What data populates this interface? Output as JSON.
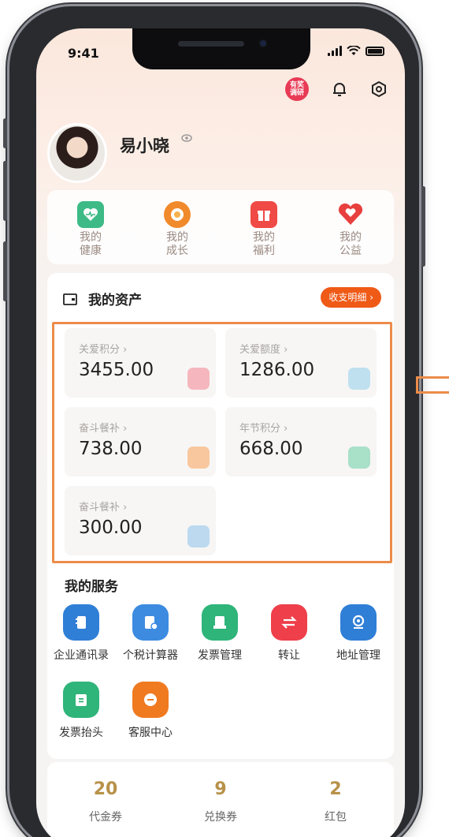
{
  "status": {
    "time": "9:41"
  },
  "header": {
    "survey_badge": [
      "有奖",
      "调研"
    ],
    "icons": [
      "survey-icon",
      "bell-icon",
      "settings-hex-icon"
    ]
  },
  "profile": {
    "name": "易小晓"
  },
  "quick": [
    {
      "label1": "我的",
      "label2": "健康",
      "icon": "heart-pulse-icon",
      "color": "#3dba86"
    },
    {
      "label1": "我的",
      "label2": "成长",
      "icon": "medal-icon",
      "color": "#f08a2b"
    },
    {
      "label1": "我的",
      "label2": "福利",
      "icon": "gift-icon",
      "color": "#ef4a45"
    },
    {
      "label1": "我的",
      "label2": "公益",
      "icon": "charity-heart-icon",
      "color": "#e8403e"
    }
  ],
  "assets": {
    "title": "我的资产",
    "detail_label": "收支明细",
    "tiles": [
      {
        "label": "关爱积分",
        "value": "3455.00",
        "icon_color": "#f5b7bd"
      },
      {
        "label": "关爱额度",
        "value": "1286.00",
        "icon_color": "#bfe0ef"
      },
      {
        "label": "奋斗餐补",
        "value": "738.00",
        "icon_color": "#f8c79e"
      },
      {
        "label": "年节积分",
        "value": "668.00",
        "icon_color": "#a9e0c8"
      },
      {
        "label": "奋斗餐补",
        "value": "300.00",
        "icon_color": "#bcd9ef"
      }
    ]
  },
  "services": {
    "title": "我的服务",
    "items": [
      {
        "label": "企业通讯录",
        "icon": "contacts-icon",
        "color": "#2f7fd6"
      },
      {
        "label": "个税计算器",
        "icon": "calculator-icon",
        "color": "#3c8be0"
      },
      {
        "label": "发票管理",
        "icon": "invoice-icon",
        "color": "#2fb47a"
      },
      {
        "label": "转让",
        "icon": "transfer-icon",
        "color": "#ee3f4a"
      },
      {
        "label": "地址管理",
        "icon": "location-icon",
        "color": "#2f7fd6"
      },
      {
        "label": "发票抬头",
        "icon": "invoice-title-icon",
        "color": "#2fb47a"
      },
      {
        "label": "客服中心",
        "icon": "customer-service-icon",
        "color": "#f07a20"
      }
    ]
  },
  "stats": [
    {
      "value": "20",
      "label": "代金券"
    },
    {
      "value": "9",
      "label": "兑换券"
    },
    {
      "value": "2",
      "label": "红包"
    }
  ]
}
